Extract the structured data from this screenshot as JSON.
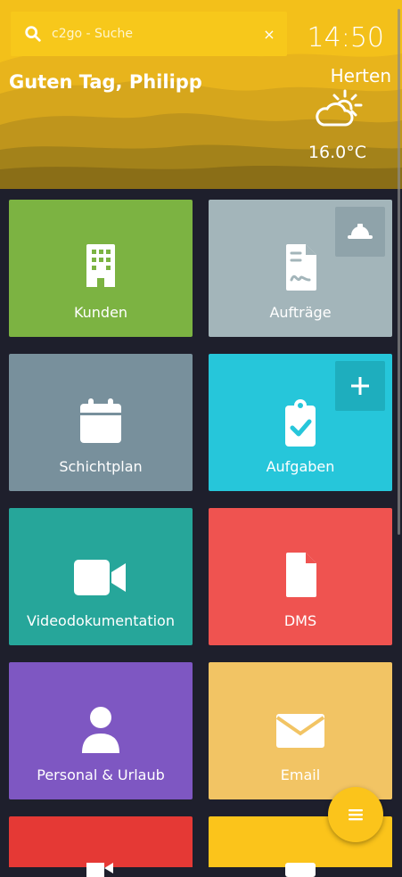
{
  "search": {
    "placeholder": "c2go - Suche",
    "clear_label": "×"
  },
  "header": {
    "time": "14:50",
    "greeting": "Guten Tag, Philipp",
    "city": "Herten",
    "temperature": "16.0°C",
    "weather_icon": "partly-cloudy-icon",
    "accent_color": "#e9b81a"
  },
  "tiles": [
    {
      "label": "Kunden",
      "icon": "building-icon",
      "color": "#7cb342"
    },
    {
      "label": "Aufträge",
      "icon": "contract-icon",
      "color": "#a3b5ba",
      "corner_icon": "hardhat-icon"
    },
    {
      "label": "Schichtplan",
      "icon": "calendar-icon",
      "color": "#78909c"
    },
    {
      "label": "Aufgaben",
      "icon": "clipboard-check-icon",
      "color": "#26c6da",
      "corner_icon": "plus-icon"
    },
    {
      "label": "Videodokumentation",
      "icon": "video-camera-icon",
      "color": "#26a69a"
    },
    {
      "label": "DMS",
      "icon": "document-icon",
      "color": "#ef5350"
    },
    {
      "label": "Personal & Urlaub",
      "icon": "user-icon",
      "color": "#7e57c2"
    },
    {
      "label": "Email",
      "icon": "envelope-icon",
      "color": "#f2c464"
    },
    {
      "label": "",
      "icon": "logout-icon",
      "color": "#e53935"
    },
    {
      "label": "",
      "icon": "mail-icon",
      "color": "#fbc41b"
    }
  ],
  "fab": {
    "icon": "menu-icon"
  }
}
